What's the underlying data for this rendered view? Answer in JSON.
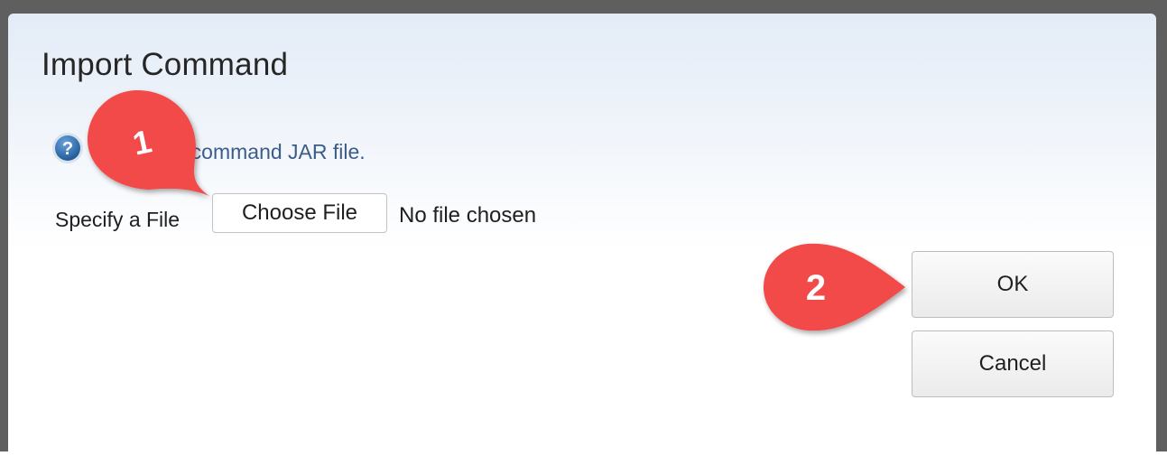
{
  "dialog": {
    "title": "Import Command",
    "help_icon": "question-mark-icon",
    "instruction": "Select the command JAR file.",
    "specify_label": "Specify a File",
    "choose_file_label": "Choose File",
    "file_status": "No file chosen",
    "ok_label": "OK",
    "cancel_label": "Cancel"
  },
  "annotations": [
    {
      "label": "1",
      "icon": "callout-pin-icon",
      "color": "#f24a4a"
    },
    {
      "label": "2",
      "icon": "callout-arrow-icon",
      "color": "#f24a4a"
    }
  ],
  "colors": {
    "title_text": "#262626",
    "instruction_text": "#3b5c8a",
    "help_icon_fill": "#2f6aa6",
    "callout_red": "#f24a4a"
  }
}
